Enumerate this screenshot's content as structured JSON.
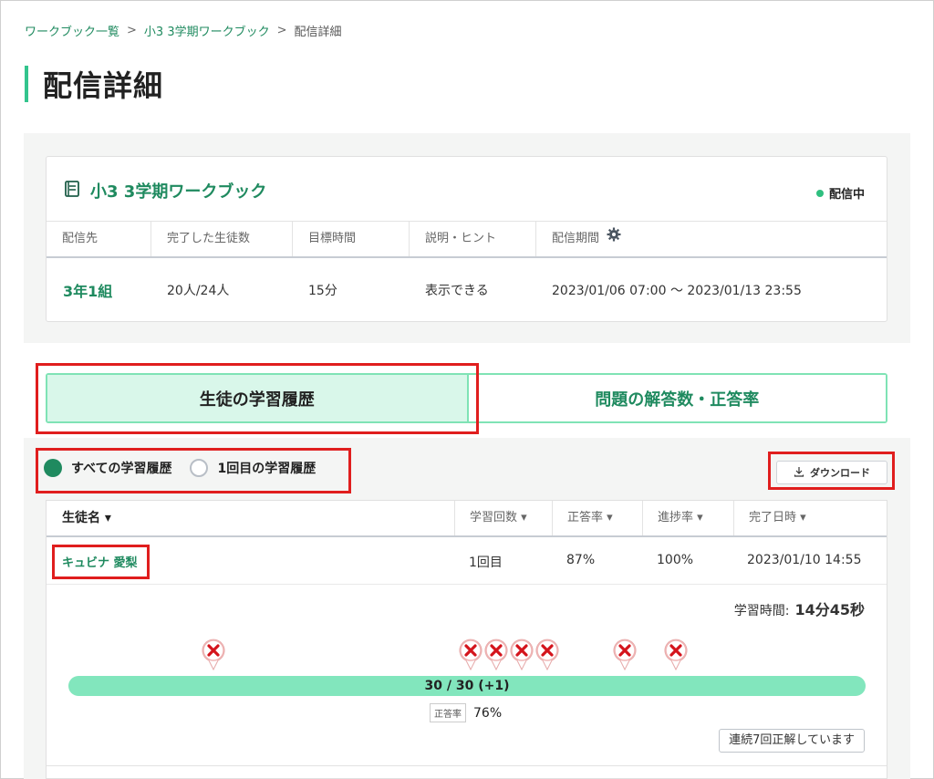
{
  "breadcrumb": {
    "items": [
      "ワークブック一覧",
      "小3 3学期ワークブック"
    ],
    "current": "配信詳細",
    "sep": ">"
  },
  "page_title": "配信詳細",
  "card": {
    "title": "小3 3学期ワークブック",
    "status": "配信中",
    "columns": [
      "配信先",
      "完了した生徒数",
      "目標時間",
      "説明・ヒント",
      "配信期間"
    ],
    "row": {
      "class": "3年1組",
      "completed": "20人/24人",
      "target_time": "15分",
      "hint": "表示できる",
      "period": "2023/01/06 07:00 〜 2023/01/13 23:55"
    }
  },
  "tabs": [
    {
      "label": "生徒の学習履歴",
      "active": true
    },
    {
      "label": "問題の解答数・正答率",
      "active": false
    }
  ],
  "filter": {
    "all_label": "すべての学習履歴",
    "first_label": "1回目の学習履歴",
    "selected": "all"
  },
  "download_label": "ダウンロード",
  "list": {
    "headers": {
      "name": "生徒名 ▾",
      "count": "学習回数 ▾",
      "rate": "正答率 ▾",
      "progress": "進捗率 ▾",
      "done": "完了日時 ▾"
    },
    "row": {
      "name": "キュビナ 愛梨",
      "count": "1回目",
      "rate": "87%",
      "progress": "100%",
      "done": "2023/01/10 14:55"
    },
    "study_time_label": "学習時間:",
    "study_time_value": "14分45秒",
    "progress_text": "30 / 30 (+1)",
    "progress_fraction": 1.0,
    "rate_label": "正答率",
    "rate_value": "76%",
    "streak_label": "連続7回正解しています",
    "wrong_marker_icon": "wrong-x-pin-icon",
    "wrong_marker_count": 7
  },
  "colors": {
    "accent": "#1f8a5f",
    "light_accent": "#33c48d",
    "highlight": "#e01e1e"
  }
}
